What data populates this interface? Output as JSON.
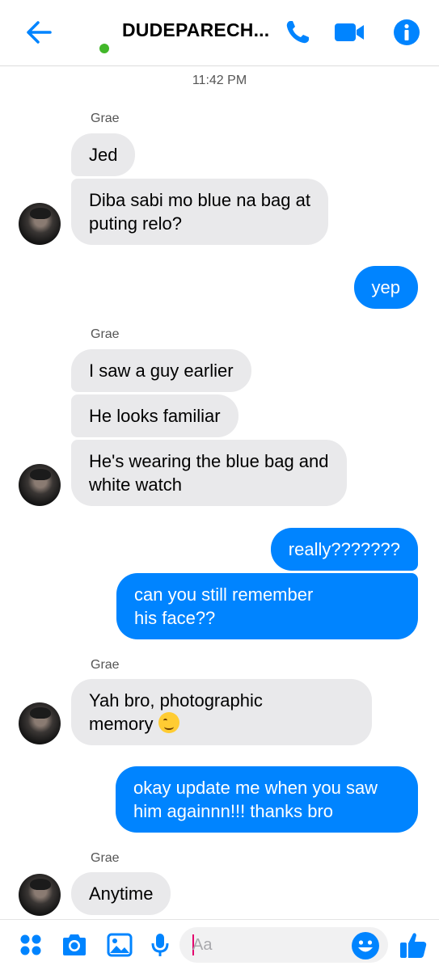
{
  "header": {
    "title": "DUDEPARECH...",
    "presence_color": "#42b72a",
    "icons": [
      "back-arrow-icon",
      "phone-icon",
      "video-camera-icon",
      "info-icon"
    ]
  },
  "thread": {
    "timestamp": "11:42 PM",
    "messages": [
      {
        "sender": "Grae",
        "text": "Jed",
        "direction": "incoming"
      },
      {
        "text": "Diba sabi mo blue na bag at",
        "text2": "puting relo?",
        "direction": "incoming"
      },
      {
        "text": "yep",
        "direction": "outgoing"
      },
      {
        "sender": "Grae",
        "text": "I saw a guy earlier",
        "direction": "incoming"
      },
      {
        "text": "He looks familiar",
        "direction": "incoming"
      },
      {
        "text": "He's wearing the blue bag and",
        "text2": "white watch",
        "direction": "incoming"
      },
      {
        "text": "really???????",
        "direction": "outgoing"
      },
      {
        "text": "can you still remember",
        "text2": "his face??",
        "direction": "outgoing"
      },
      {
        "sender": "Grae",
        "text": "Yah bro, photographic",
        "text2": "memory",
        "emoji": "winking-face-emoji",
        "direction": "incoming"
      },
      {
        "text": "okay update me when you saw",
        "text2": "him againnn!!! thanks bro",
        "direction": "outgoing"
      },
      {
        "sender": "Grae",
        "text": "Anytime",
        "direction": "incoming"
      }
    ]
  },
  "composer": {
    "placeholder": "Aa",
    "icons": [
      "apps-grid-icon",
      "camera-icon",
      "image-icon",
      "microphone-icon",
      "emoji-icon",
      "thumbs-up-icon"
    ]
  },
  "colors": {
    "accent": "#0084ff",
    "incoming_bubble": "#e9e9eb",
    "outgoing_bubble": "#0084ff"
  }
}
